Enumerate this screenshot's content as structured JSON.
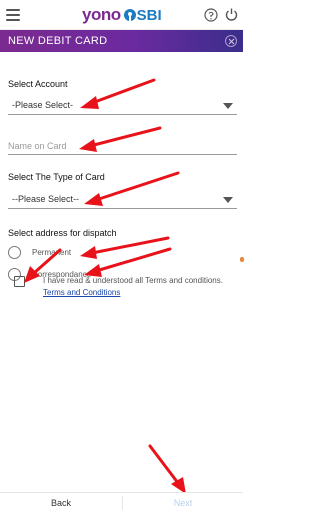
{
  "header": {
    "logo_yono": "yono",
    "logo_sbi": "SBI",
    "brand_purple": "#7b2a8f",
    "brand_blue": "#1b7cc2"
  },
  "titlebar": {
    "title": "NEW DEBIT CARD"
  },
  "form": {
    "account": {
      "label": "Select Account",
      "value": "-Please Select-"
    },
    "name_on_card": {
      "placeholder": "Name on Card",
      "value": ""
    },
    "card_type": {
      "label": "Select The Type of Card",
      "value": "--Please Select--"
    },
    "dispatch": {
      "label": "Select address for dispatch",
      "options": [
        "Permanent",
        "Correspondance"
      ],
      "selected": null
    },
    "terms": {
      "text": "I have read & understood all Terms and conditions.",
      "link": "Terms and Conditions",
      "checked": false
    }
  },
  "footer": {
    "back_label": "Back",
    "next_label": "Next",
    "next_enabled": false
  },
  "annotation": {
    "arrow_color": "#e8121a"
  }
}
